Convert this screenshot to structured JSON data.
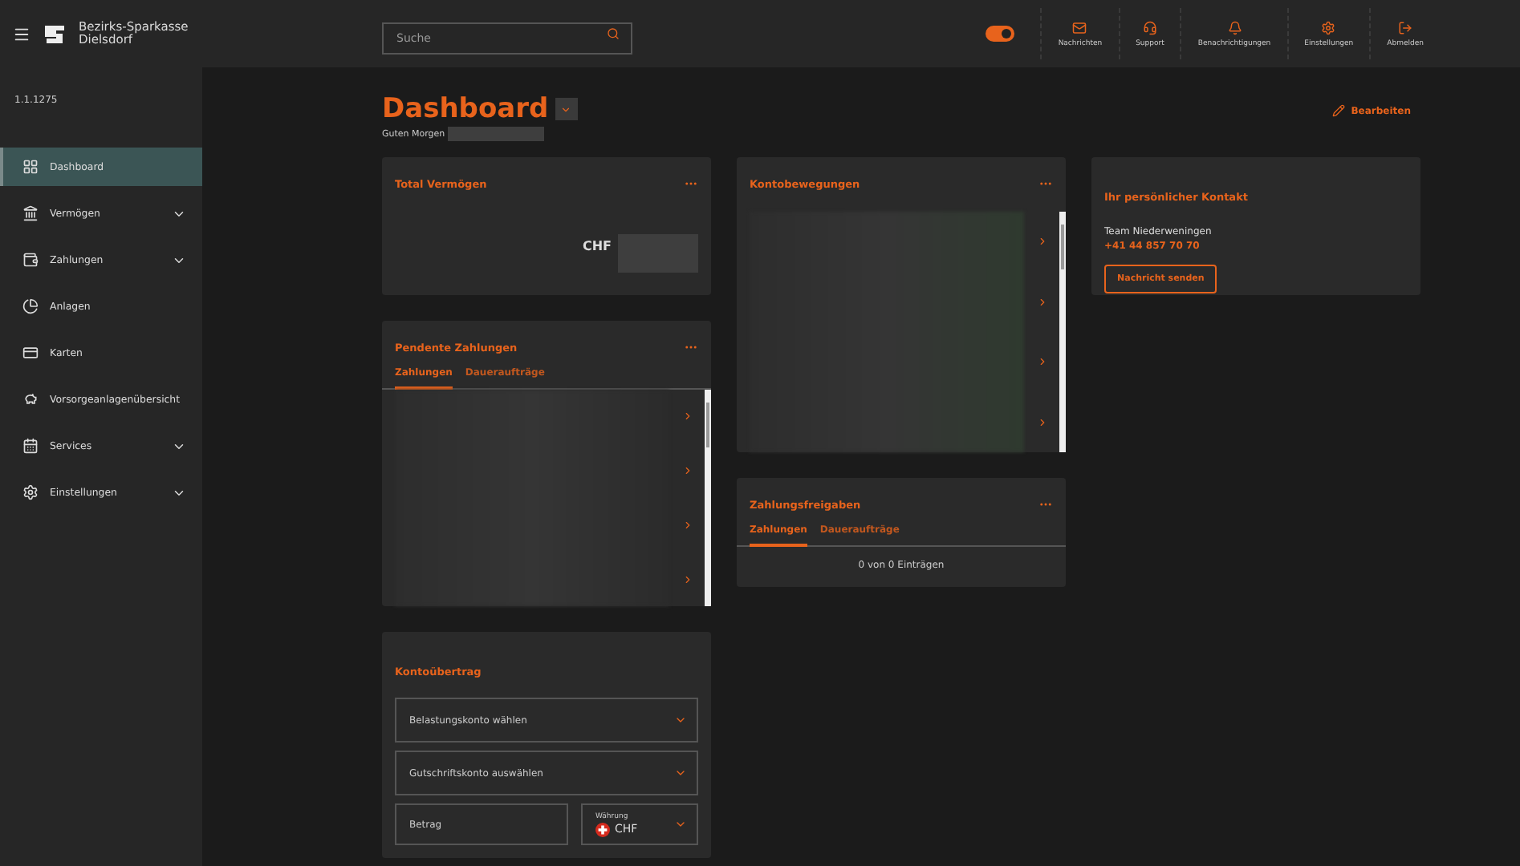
{
  "header": {
    "logo_line1": "Bezirks-Sparkasse",
    "logo_line2": "Dielsdorf",
    "search": {
      "placeholder": "Suche"
    },
    "toggle": {
      "on": true
    },
    "actions": [
      {
        "label": "Nachrichten"
      },
      {
        "label": "Support"
      },
      {
        "label": "Benachrichtigungen"
      },
      {
        "label": "Einstellungen"
      },
      {
        "label": "Abmelden"
      }
    ]
  },
  "sidebar": {
    "version": "1.1.1275",
    "items": [
      {
        "label": "Dashboard",
        "selected": true,
        "expandable": false
      },
      {
        "label": "Vermögen",
        "selected": false,
        "expandable": true
      },
      {
        "label": "Zahlungen",
        "selected": false,
        "expandable": true
      },
      {
        "label": "Anlagen",
        "selected": false,
        "expandable": false
      },
      {
        "label": "Karten",
        "selected": false,
        "expandable": false
      },
      {
        "label": "Vorsorgeanlagenübersicht",
        "selected": false,
        "expandable": false
      },
      {
        "label": "Services",
        "selected": false,
        "expandable": true
      },
      {
        "label": "Einstellungen",
        "selected": false,
        "expandable": true
      }
    ]
  },
  "page": {
    "title": "Dashboard",
    "greeting": "Guten Morgen",
    "edit": "Bearbeiten"
  },
  "total_assets": {
    "title": "Total Vermögen",
    "currency": "CHF"
  },
  "pending_payments": {
    "title": "Pendente Zahlungen",
    "tabs": [
      {
        "label": "Zahlungen",
        "selected": true
      },
      {
        "label": "Daueraufträge",
        "selected": false
      }
    ]
  },
  "account_transfer": {
    "title": "Kontoübertrag",
    "fields": [
      {
        "kind": "select",
        "placeholder": "Belastungskonto wählen"
      },
      {
        "kind": "select",
        "placeholder": "Gutschriftskonto auswählen"
      },
      {
        "kind": "amount",
        "placeholder": "Betrag",
        "currency_label": "Währung",
        "currency": "CHF"
      }
    ]
  },
  "account_movements": {
    "title": "Kontobewegungen"
  },
  "payment_approvals": {
    "title": "Zahlungsfreigaben",
    "tabs": [
      {
        "label": "Zahlungen",
        "selected": true
      },
      {
        "label": "Daueraufträge",
        "selected": false
      }
    ],
    "empty_text": "0 von 0 Einträgen"
  },
  "contact": {
    "title": "Ihr persönlicher Kontakt",
    "team": "Team Niederweningen",
    "phone": "+41 44 857 70 70",
    "button": "Nachricht senden"
  }
}
